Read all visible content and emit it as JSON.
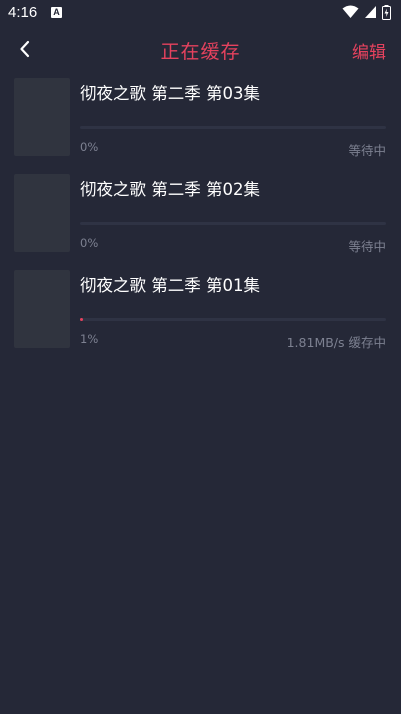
{
  "status_bar": {
    "time": "4:16",
    "app_icon_letter": "A",
    "icons": [
      "wifi-icon",
      "signal-icon",
      "battery-charging-icon"
    ]
  },
  "header": {
    "back_icon": "chevron-left-icon",
    "title": "正在缓存",
    "edit_label": "编辑"
  },
  "colors": {
    "background": "#252837",
    "accent": "#e6425e",
    "thumbnail": "#30343f",
    "muted_text": "#7d8191"
  },
  "downloads": [
    {
      "title": "彻夜之歌 第二季 第03集",
      "percent_label": "0%",
      "progress": 0,
      "status": "等待中"
    },
    {
      "title": "彻夜之歌 第二季 第02集",
      "percent_label": "0%",
      "progress": 0,
      "status": "等待中"
    },
    {
      "title": "彻夜之歌 第二季 第01集",
      "percent_label": "1%",
      "progress": 0.01,
      "status": "1.81MB/s 缓存中"
    }
  ]
}
